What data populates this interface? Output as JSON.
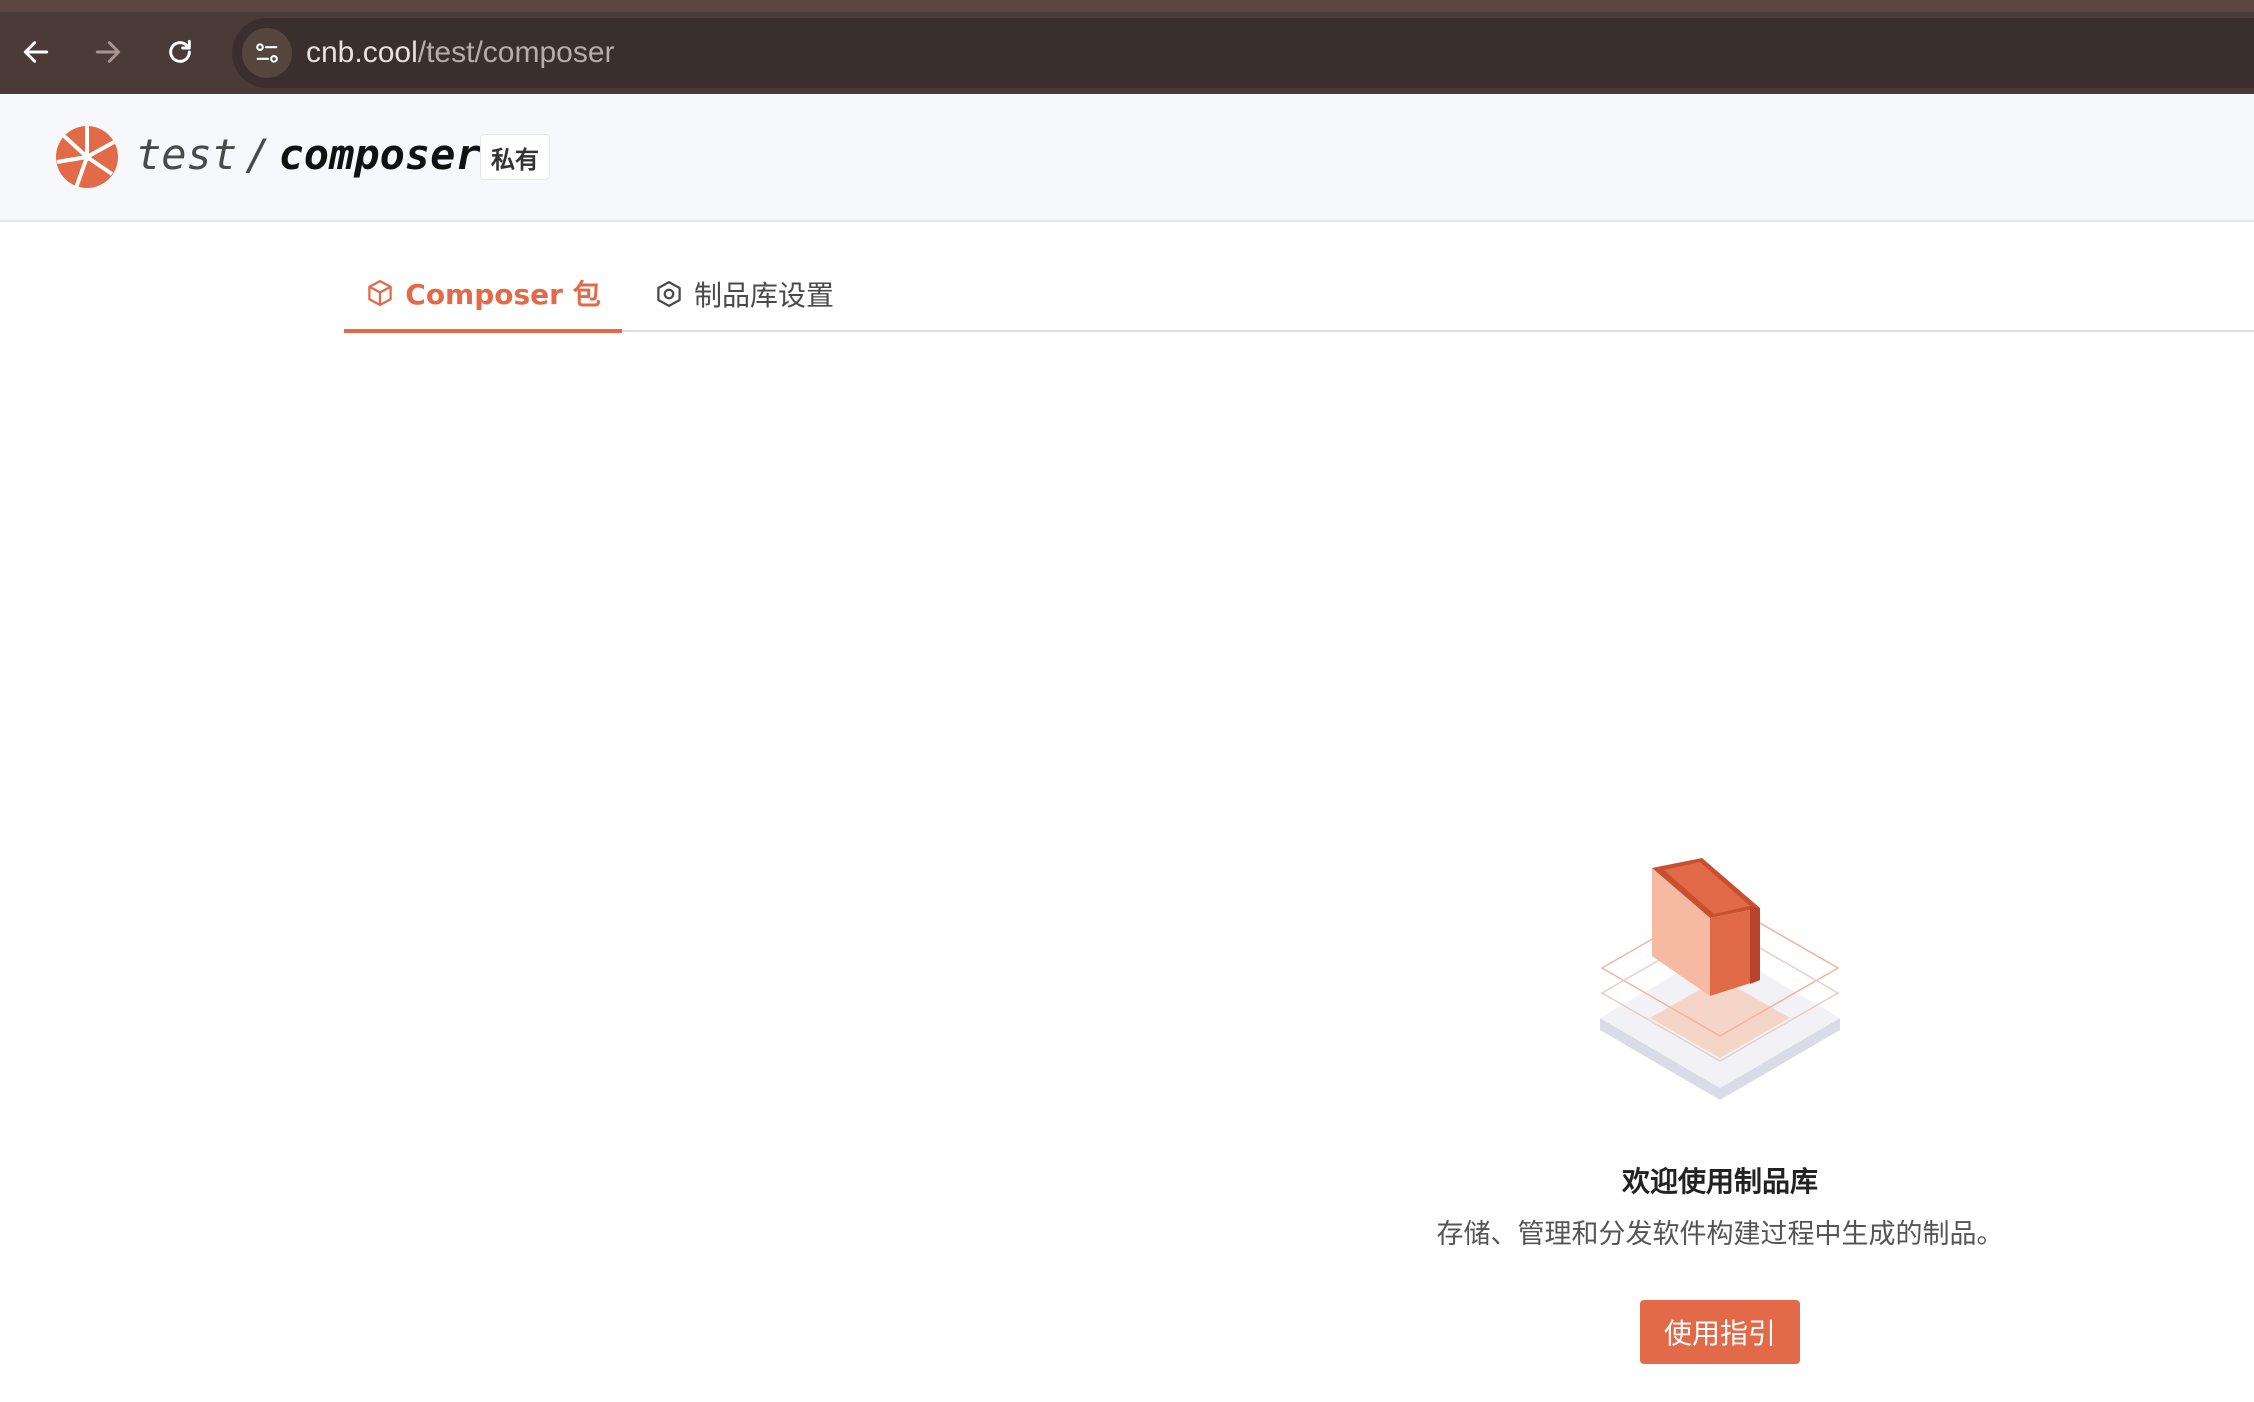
{
  "browser": {
    "url_host": "cnb.cool",
    "url_path": "/test/composer"
  },
  "repo": {
    "owner": "test",
    "separator": "/",
    "name": "composer",
    "visibility_badge": "私有"
  },
  "tabs": [
    {
      "label": "Composer 包",
      "icon": "package-icon",
      "active": true
    },
    {
      "label": "制品库设置",
      "icon": "settings-hex-icon",
      "active": false
    }
  ],
  "empty_state": {
    "title": "欢迎使用制品库",
    "description": "存储、管理和分发软件构建过程中生成的制品。",
    "button_label": "使用指引"
  },
  "colors": {
    "accent": "#e36a48",
    "browser_bar": "#4a3b39"
  }
}
